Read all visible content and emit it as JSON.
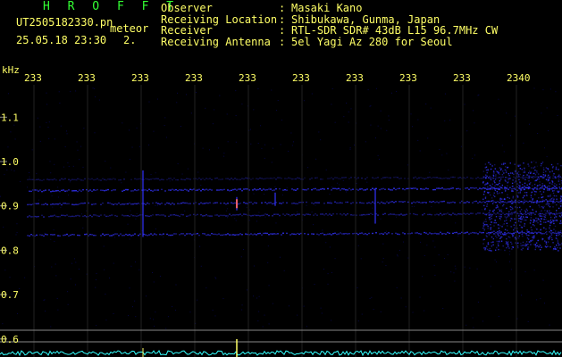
{
  "header": {
    "logo": "H R O F F T",
    "filename": "UT2505182330.pn",
    "meteor_label": "meteor",
    "timestamp": "25.05.18 23:30",
    "count": "2.",
    "fields": [
      {
        "key": "Observer",
        "value": "Masaki Kano"
      },
      {
        "key": "Receiving Location",
        "value": "Shibukawa, Gunma, Japan"
      },
      {
        "key": "Receiver",
        "value": "RTL-SDR SDR# 43dB L15 96.7MHz CW"
      },
      {
        "key": "Receiving Antenna",
        "value": "5el Yagi Az 280 for Seoul"
      }
    ],
    "separator": ":"
  },
  "axis": {
    "unit": "kHz",
    "x_ticks": [
      "233",
      "233",
      "233",
      "233",
      "233",
      "233",
      "233",
      "233",
      "233",
      "2340"
    ],
    "y_ticks": [
      "1.1",
      "1.0",
      "0.9",
      "0.8",
      "0.7",
      "0.6"
    ],
    "y_values": [
      1.1,
      1.0,
      0.9,
      0.8,
      0.7,
      0.6
    ]
  },
  "colors": {
    "text": "#ffff66",
    "logo": "#33ff33",
    "signal": "#3333ff",
    "spectrum": "#33ffff",
    "grid": "#888888"
  }
}
